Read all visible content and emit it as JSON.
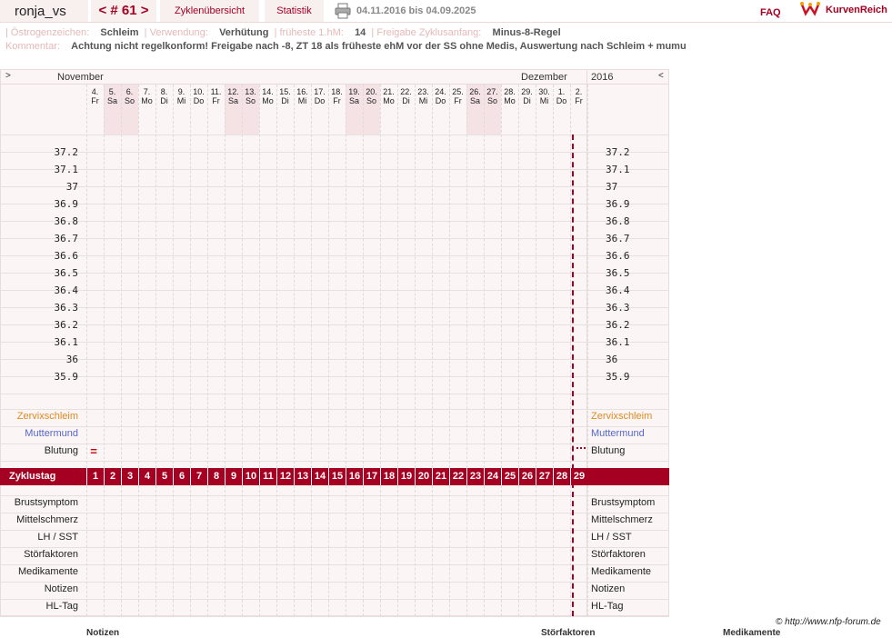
{
  "header": {
    "username": "ronja_vs",
    "cycle_nav": "< # 61 >",
    "tab_overview": "Zyklenübersicht",
    "tab_stats": "Statistik",
    "date_range": "04.11.2016 bis 04.09.2025",
    "faq": "FAQ",
    "brand": "KurvenReich"
  },
  "info": {
    "oestrogen_label": "Östrogenzeichen:",
    "oestrogen_value": "Schleim",
    "usage_label": "Verwendung:",
    "usage_value": "Verhütung",
    "earliest_label": "früheste 1.hM:",
    "earliest_value": "14",
    "release_label": "Freigabe Zyklusanfang:",
    "release_value": "Minus-8-Regel",
    "comment_label": "Kommentar:",
    "comment_value": "Achtung nicht regelkonform! Freigabe nach -8, ZT 18 als früheste ehM vor der SS ohne Medis, Auswertung nach Schleim + mumu"
  },
  "chart": {
    "nav_left": ">",
    "nav_right": "<",
    "month_left": "November",
    "month_right": "Dezember",
    "year": "2016",
    "days": [
      {
        "d": "4.",
        "w": "Fr"
      },
      {
        "d": "5.",
        "w": "Sa"
      },
      {
        "d": "6.",
        "w": "So"
      },
      {
        "d": "7.",
        "w": "Mo"
      },
      {
        "d": "8.",
        "w": "Di"
      },
      {
        "d": "9.",
        "w": "Mi"
      },
      {
        "d": "10.",
        "w": "Do"
      },
      {
        "d": "11.",
        "w": "Fr"
      },
      {
        "d": "12.",
        "w": "Sa"
      },
      {
        "d": "13.",
        "w": "So"
      },
      {
        "d": "14.",
        "w": "Mo"
      },
      {
        "d": "15.",
        "w": "Di"
      },
      {
        "d": "16.",
        "w": "Mi"
      },
      {
        "d": "17.",
        "w": "Do"
      },
      {
        "d": "18.",
        "w": "Fr"
      },
      {
        "d": "19.",
        "w": "Sa"
      },
      {
        "d": "20.",
        "w": "So"
      },
      {
        "d": "21.",
        "w": "Mo"
      },
      {
        "d": "22.",
        "w": "Di"
      },
      {
        "d": "23.",
        "w": "Mi"
      },
      {
        "d": "24.",
        "w": "Do"
      },
      {
        "d": "25.",
        "w": "Fr"
      },
      {
        "d": "26.",
        "w": "Sa"
      },
      {
        "d": "27.",
        "w": "So"
      },
      {
        "d": "28.",
        "w": "Mo"
      },
      {
        "d": "29.",
        "w": "Di"
      },
      {
        "d": "30.",
        "w": "Mi"
      },
      {
        "d": "1.",
        "w": "Do"
      },
      {
        "d": "2.",
        "w": "Fr"
      }
    ],
    "temperatures": [
      "37.2",
      "37.1",
      "37",
      "36.9",
      "36.8",
      "36.7",
      "36.6",
      "36.5",
      "36.4",
      "36.3",
      "36.2",
      "36.1",
      "36",
      "35.9"
    ],
    "label_cervix": "Zervixschleim",
    "label_cervix_color": "#e08a1e",
    "label_mumu": "Muttermund",
    "label_mumu_color": "#5566cc",
    "label_bleeding": "Blutung",
    "bleeding_marker": "=",
    "bleeding_color": "#cc0000",
    "cycle_day_label": "Zyklustag",
    "cycle_days": [
      "1",
      "2",
      "3",
      "4",
      "5",
      "6",
      "7",
      "8",
      "9",
      "10",
      "11",
      "12",
      "13",
      "14",
      "15",
      "16",
      "17",
      "18",
      "19",
      "20",
      "21",
      "22",
      "23",
      "24",
      "25",
      "26",
      "27",
      "28",
      "29"
    ],
    "bottom_rows": [
      "Brustsymptom",
      "Mittelschmerz",
      "LH / SST",
      "Störfaktoren",
      "Medikamente",
      "Notizen",
      "HL-Tag"
    ],
    "accent": "#a50021"
  },
  "footer": {
    "copyright": "© http://www.nfp-forum.de",
    "col_notes": "Notizen",
    "col_disturb": "Störfaktoren",
    "col_meds": "Medikamente"
  }
}
